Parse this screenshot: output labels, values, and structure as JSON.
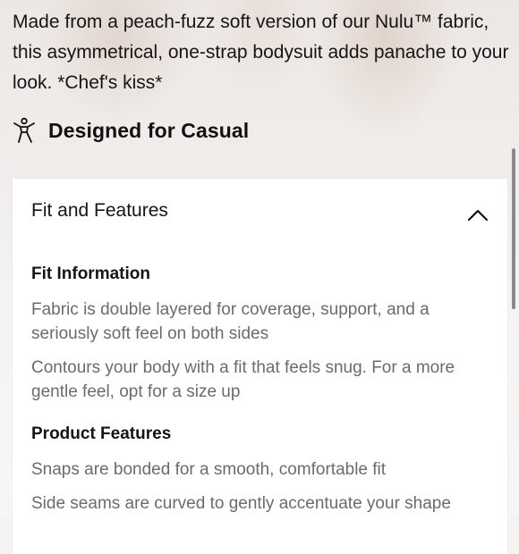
{
  "product": {
    "description": "Made from a peach-fuzz soft version of our Nulu™ fabric, this asymmetrical, one-strap bodysuit adds panache to your look. *Chef's kiss*",
    "designed_for": "Designed for Casual",
    "designed_icon": "activity-person-icon"
  },
  "fit_features": {
    "title": "Fit and Features",
    "toggle_icon": "chevron-up-icon",
    "fit_information": {
      "heading": "Fit Information",
      "items": [
        "Fabric is double layered for coverage, support, and a seriously soft feel on both sides",
        "Contours your body with a fit that feels snug. For a more gentle feel, opt for a size up"
      ]
    },
    "product_features": {
      "heading": "Product Features",
      "items": [
        "Snaps are bonded for a smooth, comfortable fit",
        "Side seams are curved to gently accentuate your shape"
      ]
    }
  }
}
